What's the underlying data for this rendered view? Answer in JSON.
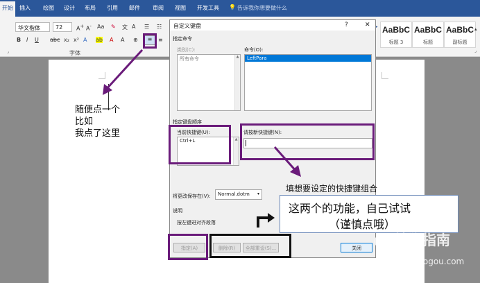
{
  "ribbon": {
    "tabs": [
      "开始",
      "插入",
      "绘图",
      "设计",
      "布局",
      "引用",
      "邮件",
      "审阅",
      "视图",
      "开发工具"
    ],
    "tell_me": "告诉我你想要做什么",
    "font_name": "华文楷体",
    "font_size": "72",
    "font_group_label": "字体",
    "styles": [
      {
        "preview": "AaBbC",
        "name": "标题 3"
      },
      {
        "preview": "AaBbC",
        "name": "标题"
      },
      {
        "preview": "AaBbC",
        "name": "副标题"
      }
    ]
  },
  "dialog": {
    "title": "自定义键盘",
    "help": "?",
    "close_glyph": "✕",
    "specify_command": "指定命令",
    "categories_label": "类别(C):",
    "categories": [
      "所有命令"
    ],
    "commands_label": "命令(O):",
    "commands": [
      "LeftPara"
    ],
    "key_sequence_label": "指定键盘顺序",
    "current_keys_label": "当前快捷键(U):",
    "current_keys": [
      "Ctrl+L"
    ],
    "new_key_label": "请按新快捷键(N):",
    "new_key_value": "",
    "save_in_label": "将更改保存在(V):",
    "save_in_value": "Normal.dotm",
    "description_label": "说明",
    "description_text": "按左键进对齐段落",
    "buttons": {
      "assign": "指定(A)",
      "remove": "删除(R)",
      "reset_all": "全部重设(S)...",
      "close": "关闭"
    }
  },
  "annotations": {
    "left_note": [
      "随便点一个",
      "比如",
      "我点了这里"
    ],
    "shortcut_note": "填想要设定的快捷键组合",
    "tip_line1": "这两个的功能，自己试试",
    "tip_line2": "（谨慎点哦）",
    "watermark": "搜狗指南",
    "watermark_url": "zhinan.sogou.com",
    "highlight_color": "#6a1b7a"
  }
}
